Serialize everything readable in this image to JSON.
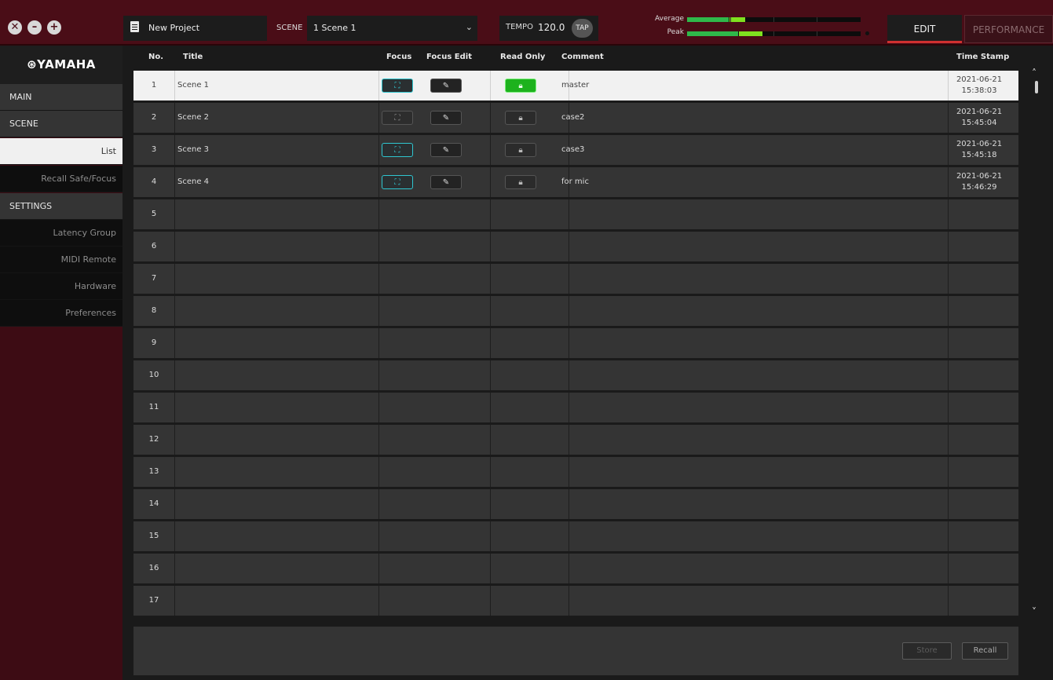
{
  "window": {
    "close_glyph": "✕",
    "minimize_glyph": "–",
    "maximize_glyph": "+"
  },
  "topbar": {
    "project_name": "New Project",
    "scene_label": "SCENE",
    "scene_value": "1  Scene 1",
    "tempo_label": "TEMPO",
    "tempo_value": "120.0",
    "tap_label": "TAP",
    "meter_average_label": "Average",
    "meter_peak_label": "Peak",
    "edit_label": "EDIT",
    "performance_label": "PERFORMANCE",
    "colors": {
      "meter_green": "#2fb84a",
      "meter_light": "#7fe11f",
      "accent_red": "#d03030"
    }
  },
  "sidebar": {
    "logo": "⊛YAMAHA",
    "items": [
      {
        "label": "MAIN",
        "kind": "head"
      },
      {
        "label": "SCENE",
        "kind": "head"
      },
      {
        "label": "List",
        "kind": "sub",
        "active": true
      },
      {
        "label": "Recall Safe/Focus",
        "kind": "sub"
      },
      {
        "label": "SETTINGS",
        "kind": "head"
      },
      {
        "label": "Latency Group",
        "kind": "sub"
      },
      {
        "label": "MIDI Remote",
        "kind": "sub"
      },
      {
        "label": "Hardware",
        "kind": "sub"
      },
      {
        "label": "Preferences",
        "kind": "sub"
      }
    ]
  },
  "table": {
    "headers": {
      "no": "No.",
      "title": "Title",
      "focus": "Focus",
      "focus_edit": "Focus Edit",
      "read_only": "Read Only",
      "comment": "Comment",
      "time_stamp": "Time Stamp"
    },
    "rows": [
      {
        "no": "1",
        "title": "Scene 1",
        "focus_on": true,
        "read_only": true,
        "comment": "master",
        "date": "2021-06-21",
        "time": "15:38:03",
        "selected": true
      },
      {
        "no": "2",
        "title": "Scene 2",
        "focus_on": false,
        "read_only": false,
        "comment": "case2",
        "date": "2021-06-21",
        "time": "15:45:04"
      },
      {
        "no": "3",
        "title": "Scene 3",
        "focus_on": true,
        "read_only": false,
        "comment": "case3",
        "date": "2021-06-21",
        "time": "15:45:18"
      },
      {
        "no": "4",
        "title": "Scene 4",
        "focus_on": true,
        "read_only": false,
        "comment": "for mic",
        "date": "2021-06-21",
        "time": "15:46:29"
      },
      {
        "no": "5"
      },
      {
        "no": "6"
      },
      {
        "no": "7"
      },
      {
        "no": "8"
      },
      {
        "no": "9"
      },
      {
        "no": "10"
      },
      {
        "no": "11"
      },
      {
        "no": "12"
      },
      {
        "no": "13"
      },
      {
        "no": "14"
      },
      {
        "no": "15"
      },
      {
        "no": "16"
      },
      {
        "no": "17"
      }
    ]
  },
  "footer": {
    "store_label": "Store",
    "recall_label": "Recall"
  }
}
